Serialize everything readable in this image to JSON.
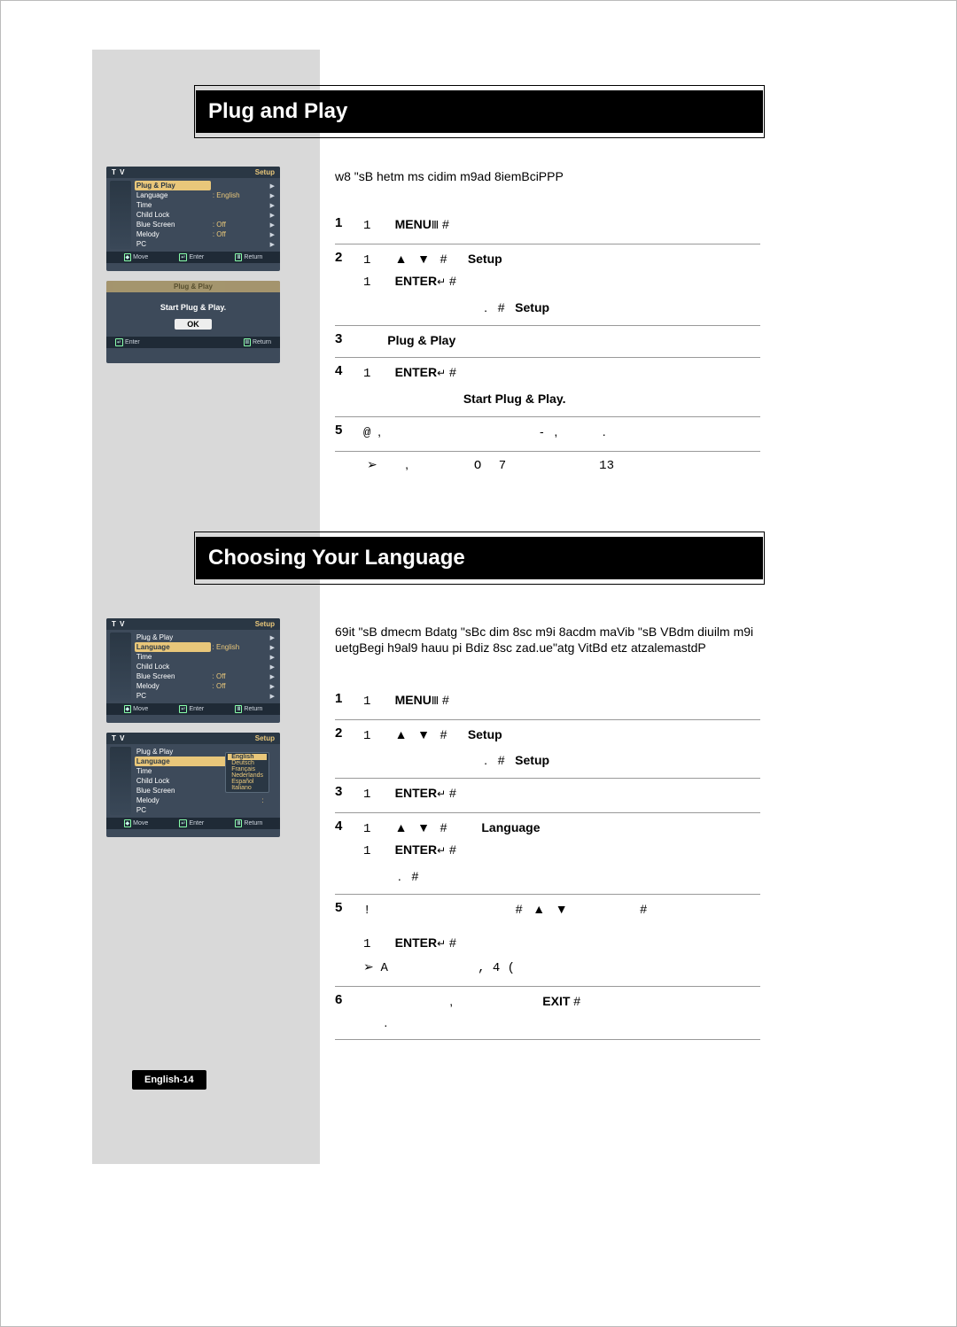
{
  "page_number_label": "English-14",
  "section1_title": "Plug and Play",
  "section2_title": "Choosing Your Language",
  "intro1": "w8 \"sB hetm ms cidim m9ad 8iemBciPPP",
  "intro2": "69it \"sB dmecm Bdatg \"sBc dim 8sc m9i 8acdm maVib \"sB VBdm diuilm m9i uetgBegi h9al9 hauu pi Bdiz 8sc zad.ue\"atg VitBd etz atzalemastdP",
  "menu_label": "MENU",
  "enter_label": "ENTER",
  "exit_label": "EXIT",
  "setup_label": "Setup",
  "plugplay_label": "Plug & Play",
  "startpp_label": "Start Plug & Play.",
  "language_label": "Language",
  "s1": {
    "1": {
      "num": "1",
      "a": "1"
    },
    "2": {
      "num": "2",
      "a": "1",
      "b": "1"
    },
    "3": {
      "num": "3"
    },
    "4": {
      "num": "4",
      "a": "1"
    },
    "5": {
      "num": "5",
      "a": "@"
    },
    "note": {
      "a": ",",
      "b": "O",
      "c": "7",
      "d": "13"
    }
  },
  "s2": {
    "1": {
      "num": "1",
      "a": "1"
    },
    "2": {
      "num": "2",
      "a": "1"
    },
    "3": {
      "num": "3",
      "a": "1"
    },
    "4": {
      "num": "4",
      "a": "1",
      "b": "1"
    },
    "5": {
      "num": "5",
      "a": "!",
      "b": "1",
      "note_a": "A",
      "note_b": ",  4 ("
    },
    "6": {
      "num": "6"
    }
  },
  "osd_setup_items": [
    {
      "label": "Plug & Play",
      "val": "",
      "arrow": true
    },
    {
      "label": "Language",
      "val": ": English",
      "arrow": true
    },
    {
      "label": "Time",
      "val": "",
      "arrow": true
    },
    {
      "label": "Child Lock",
      "val": "",
      "arrow": true
    },
    {
      "label": "Blue Screen",
      "val": ": Off",
      "arrow": true
    },
    {
      "label": "Melody",
      "val": ": Off",
      "arrow": true
    },
    {
      "label": "PC",
      "val": "",
      "arrow": true
    }
  ],
  "osd_langlist": [
    "English",
    "Deutsch",
    "Français",
    "Nederlands",
    "Español",
    "Italiano"
  ],
  "osd_header_left": "T V",
  "osd_header_right": "Setup",
  "osd_pp_header": "Plug & Play",
  "osd_pp_msg": "Start Plug & Play.",
  "osd_ok": "OK",
  "osd_ft_move": "Move",
  "osd_ft_enter": "Enter",
  "osd_ft_return": "Return"
}
